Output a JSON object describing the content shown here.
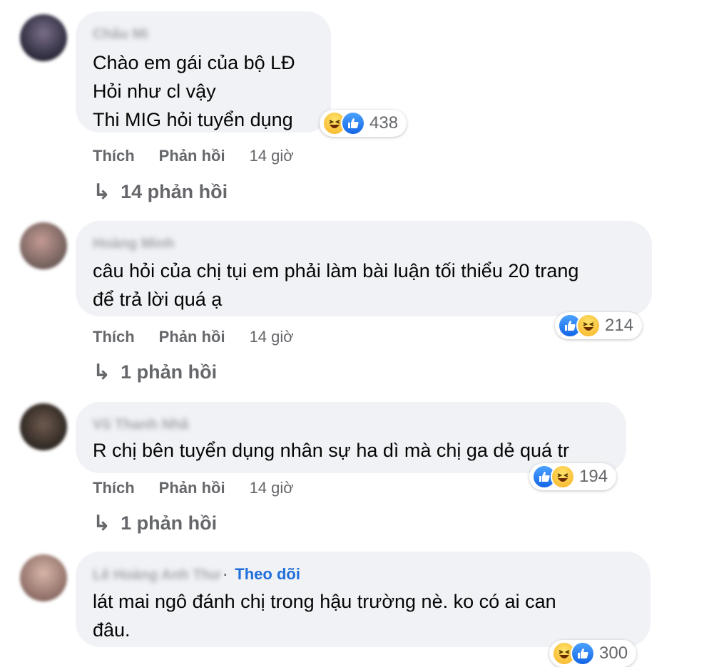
{
  "colors": {
    "bubble_bg": "#f0f2f5",
    "meta_text": "#65676b",
    "follow_link": "#216fdb",
    "like_blue": "#1877f2",
    "haha_yellow": "#f7b125"
  },
  "comments": [
    {
      "author": "Châu Mi",
      "text": "Chào em gái của bộ LĐ\nHỏi như cl vậy\nThi MIG hỏi tuyển dụng",
      "reactions": [
        "haha-icon",
        "like-icon"
      ],
      "reaction_count": "438",
      "like_label": "Thích",
      "reply_label": "Phản hồi",
      "time": "14 giờ",
      "replies_label": "14 phản hồi"
    },
    {
      "author": "Hoàng Minh",
      "text": "câu hỏi của chị tụi em phải làm bài luận tối thiểu 20 trang\nđể trả lời quá ạ",
      "reactions": [
        "like-icon",
        "haha-icon"
      ],
      "reaction_count": "214",
      "like_label": "Thích",
      "reply_label": "Phản hồi",
      "time": "14 giờ",
      "replies_label": "1 phản hồi"
    },
    {
      "author": "Vũ Thanh Nhã",
      "text": "R chị bên tuyển dụng nhân sự ha dì mà chị ga dẻ quá tr",
      "reactions": [
        "like-icon",
        "haha-icon"
      ],
      "reaction_count": "194",
      "like_label": "Thích",
      "reply_label": "Phản hồi",
      "time": "14 giờ",
      "replies_label": "1 phản hồi"
    },
    {
      "author": "Lê Hoàng Anh Thư",
      "separator": "·",
      "follow_label": "Theo dõi",
      "text": "lát mai ngô đánh chị trong hậu trường nè. ko có ai can\nđâu.",
      "reactions": [
        "haha-icon",
        "like-icon"
      ],
      "reaction_count": "300"
    }
  ]
}
